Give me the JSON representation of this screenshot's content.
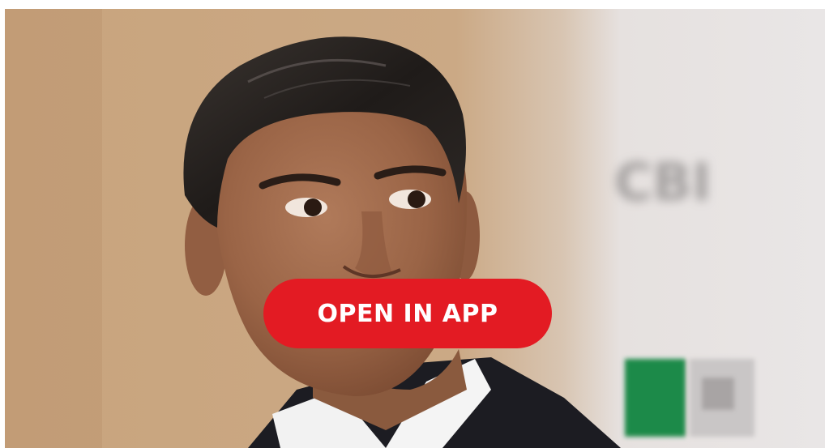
{
  "image": {
    "subject": "photo",
    "background_sign_text": "CBI"
  },
  "open_in_app": {
    "label": "OPEN IN APP"
  },
  "colors": {
    "accent": "#e31b23",
    "page_background": "#ffffff"
  }
}
